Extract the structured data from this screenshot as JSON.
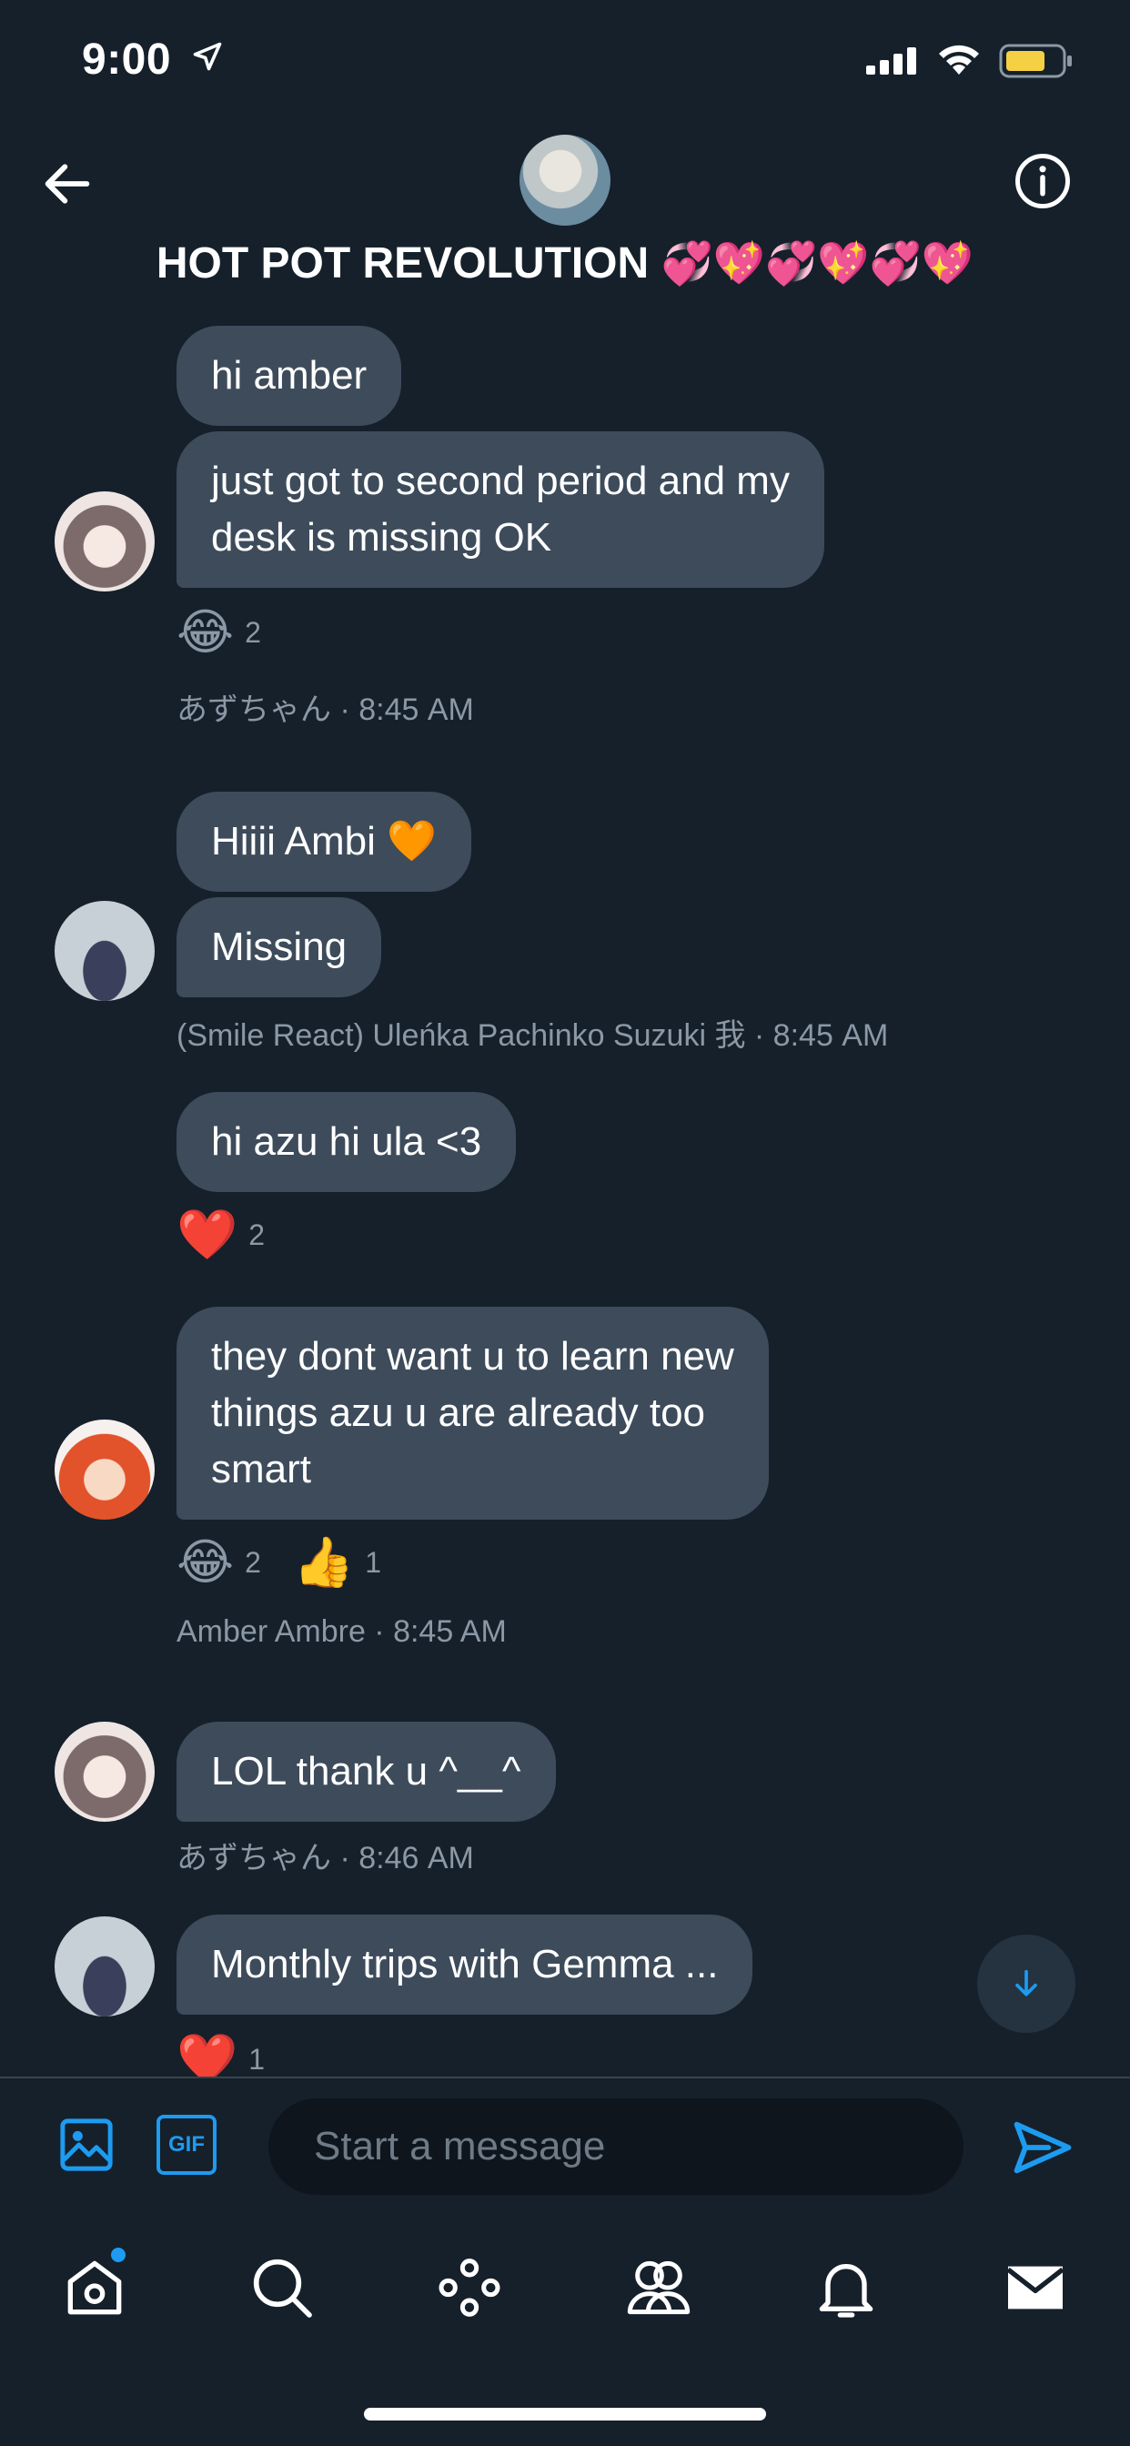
{
  "status_bar": {
    "time": "9:00"
  },
  "header": {
    "back_icon": "arrow-left-icon",
    "info_icon": "info-circle-icon",
    "title": "HOT POT REVOLUTION",
    "title_emoji": "💞💖💞💖💞💖"
  },
  "messages": [
    {
      "text": "hi amber"
    },
    {
      "text": "just got to second period and my",
      "text2": "desk is missing OK",
      "reaction_emoji": "😂",
      "reaction_count": "2",
      "meta": "あずちゃん · 8:45 AM"
    },
    {
      "text": "Hiiii Ambi 🧡"
    },
    {
      "text": "Missing",
      "meta": "(Smile React) Uleńka Pachinko Suzuki 我 · 8:45 AM"
    },
    {
      "text": "hi azu hi ula <3",
      "reaction_emoji": "❤️",
      "reaction_count": "2"
    },
    {
      "text": "they dont want u to learn new",
      "text2": "things azu u are already too",
      "text3": "smart",
      "reaction_emoji": "😂",
      "reaction_count": "2",
      "reaction2_emoji": "👍",
      "reaction2_count": "1",
      "meta": "Amber Ambre · 8:45 AM"
    },
    {
      "text": "LOL thank u ^__^",
      "meta": "あずちゃん · 8:46 AM"
    },
    {
      "text": "Monthly trips with Gemma ...",
      "reaction_emoji": "❤️",
      "reaction_count": "1"
    }
  ],
  "composer": {
    "placeholder": "Start a message",
    "gif_label": "GIF"
  },
  "tabs": [
    "home-icon",
    "search-icon",
    "spaces-icon",
    "communities-icon",
    "notifications-icon",
    "messages-icon"
  ],
  "colors": {
    "background": "#15202b",
    "bubble": "#3d4b5b",
    "accent": "#1d9bf0",
    "meta": "#8b98a5"
  }
}
